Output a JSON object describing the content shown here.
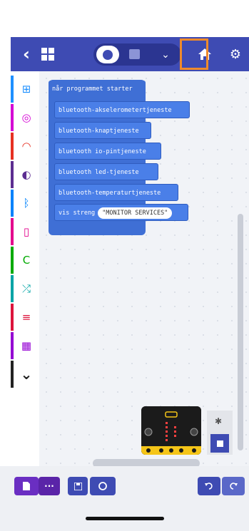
{
  "header": {
    "back_glyph": "‹",
    "dropdown_glyph": "⌄",
    "gear_glyph": "⚙",
    "accent": "#3e4bb3",
    "highlight": "#ee8a2c"
  },
  "toolbox": {
    "categories": [
      {
        "name": "basic",
        "icon": "grid-icon",
        "glyph": "⊞",
        "color": "#1e90ff"
      },
      {
        "name": "input",
        "icon": "target-icon",
        "glyph": "◎",
        "color": "#d400d4"
      },
      {
        "name": "music",
        "icon": "headphones-icon",
        "glyph": "◠",
        "color": "#e63022"
      },
      {
        "name": "led",
        "icon": "toggle-icon",
        "glyph": "◐",
        "color": "#5c2d91"
      },
      {
        "name": "bluetooth",
        "icon": "bluetooth-icon",
        "glyph": "ᛒ",
        "color": "#0082fb"
      },
      {
        "name": "radio",
        "icon": "phone-icon",
        "glyph": "▯",
        "color": "#e3008c"
      },
      {
        "name": "loops",
        "icon": "refresh-icon",
        "glyph": "C",
        "color": "#00aa00"
      },
      {
        "name": "logic",
        "icon": "shuffle-icon",
        "glyph": "⤮",
        "color": "#00a4a6"
      },
      {
        "name": "variables",
        "icon": "lines-icon",
        "glyph": "≡",
        "color": "#dc143c"
      },
      {
        "name": "math",
        "icon": "calculator-icon",
        "glyph": "▦",
        "color": "#9400d3"
      },
      {
        "name": "more",
        "icon": "chevron-down-icon",
        "glyph": "⌄",
        "color": "#222222"
      }
    ]
  },
  "workspace": {
    "hat_label": "når programmet starter",
    "blocks": [
      "bluetooth-akselerometertjeneste",
      "bluetooth-knaptjeneste",
      "bluetooth io-pintjeneste",
      "bluetooth led-tjeneste",
      "bluetooth-temperaturtjeneste"
    ],
    "show_label": "vis streng",
    "show_value": "\"MONITOR SERVICES\"",
    "block_color": "#3f6fd5"
  },
  "footer": {
    "more_glyph": "···"
  }
}
